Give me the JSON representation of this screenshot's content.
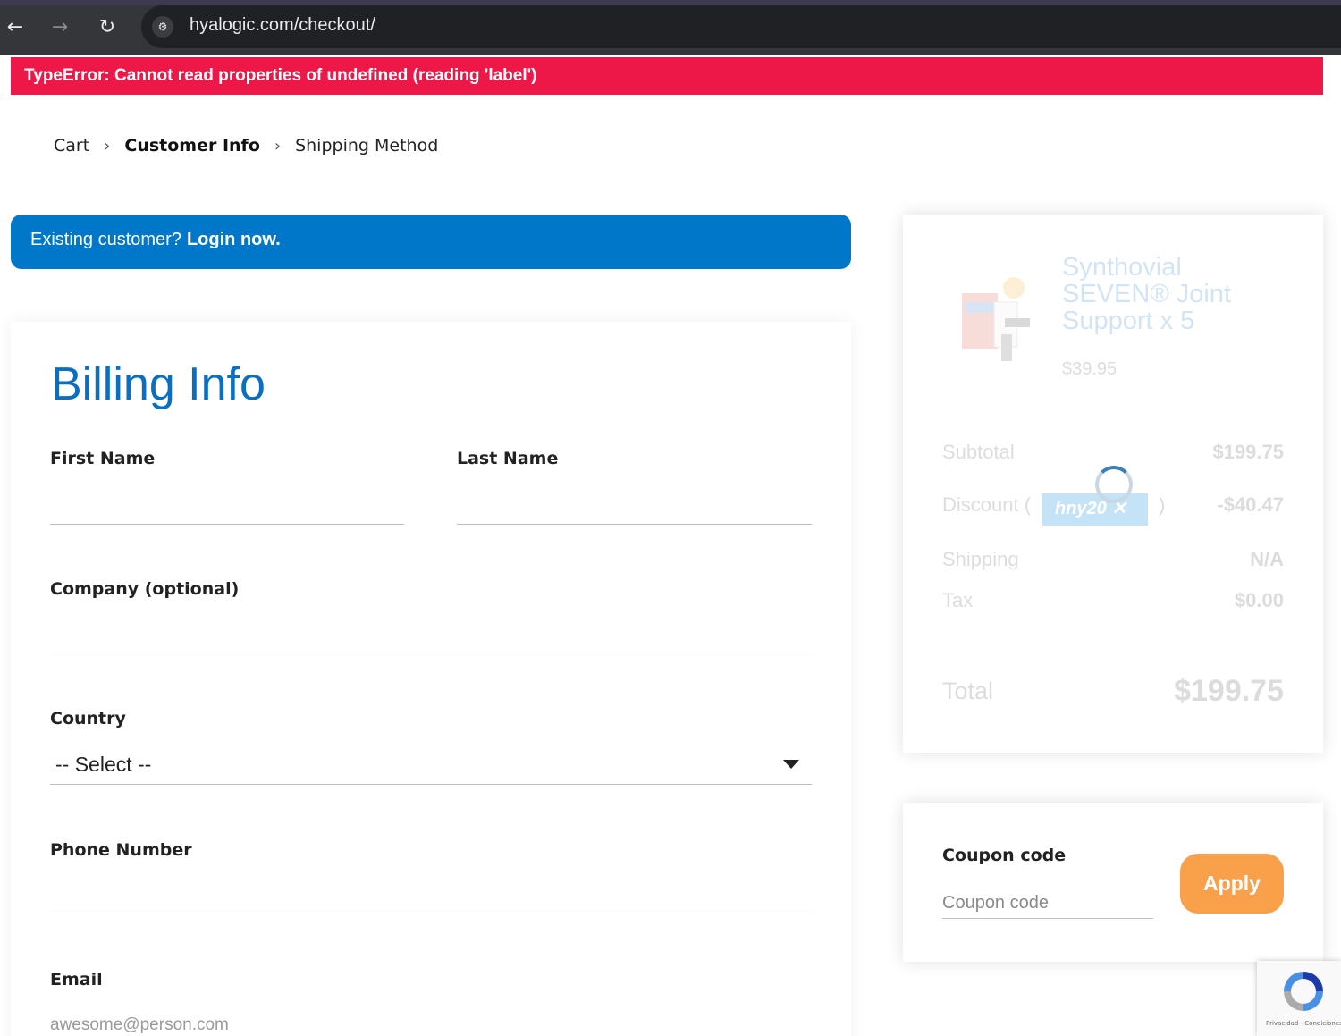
{
  "browser": {
    "back_icon": "←",
    "forward_icon": "→",
    "reload_icon": "↻",
    "site_info_icon": "⚙",
    "url": "hyalogic.com/checkout/"
  },
  "error": {
    "message": "TypeError: Cannot read properties of undefined (reading 'label')"
  },
  "breadcrumb": {
    "items": [
      {
        "label": "Cart"
      },
      {
        "label": "Customer Info"
      },
      {
        "label": "Shipping Method"
      }
    ],
    "separator": "›",
    "active_index": 1
  },
  "login_banner": {
    "text": "Existing customer?",
    "link": "Login now."
  },
  "billing": {
    "title": "Billing Info",
    "first_name_label": "First Name",
    "last_name_label": "Last Name",
    "company_label": "Company (optional)",
    "country_label": "Country",
    "country_value": "-- Select --",
    "phone_label": "Phone Number",
    "email_label": "Email",
    "email_placeholder": "awesome@person.com"
  },
  "summary": {
    "product_name": "Synthovial SEVEN® Joint Support x 5",
    "product_price": "$39.95",
    "subtotal_label": "Subtotal",
    "subtotal_value": "$199.75",
    "discount_label": "Discount (",
    "discount_close_paren": ")",
    "discount_code": "hny20 ✕",
    "discount_value": "-$40.47",
    "shipping_label": "Shipping",
    "shipping_value": "N/A",
    "tax_label": "Tax",
    "tax_value": "$0.00",
    "total_label": "Total",
    "total_value": "$199.75",
    "loading": true
  },
  "coupon": {
    "label": "Coupon code",
    "placeholder": "Coupon code",
    "button": "Apply"
  },
  "recaptcha": {
    "links": "Privacidad - Condiciones"
  },
  "colors": {
    "error": "#ed1848",
    "login_banner": "#0077c8",
    "title_blue": "#0b6fc1",
    "apply_button": "#f9a04b"
  }
}
